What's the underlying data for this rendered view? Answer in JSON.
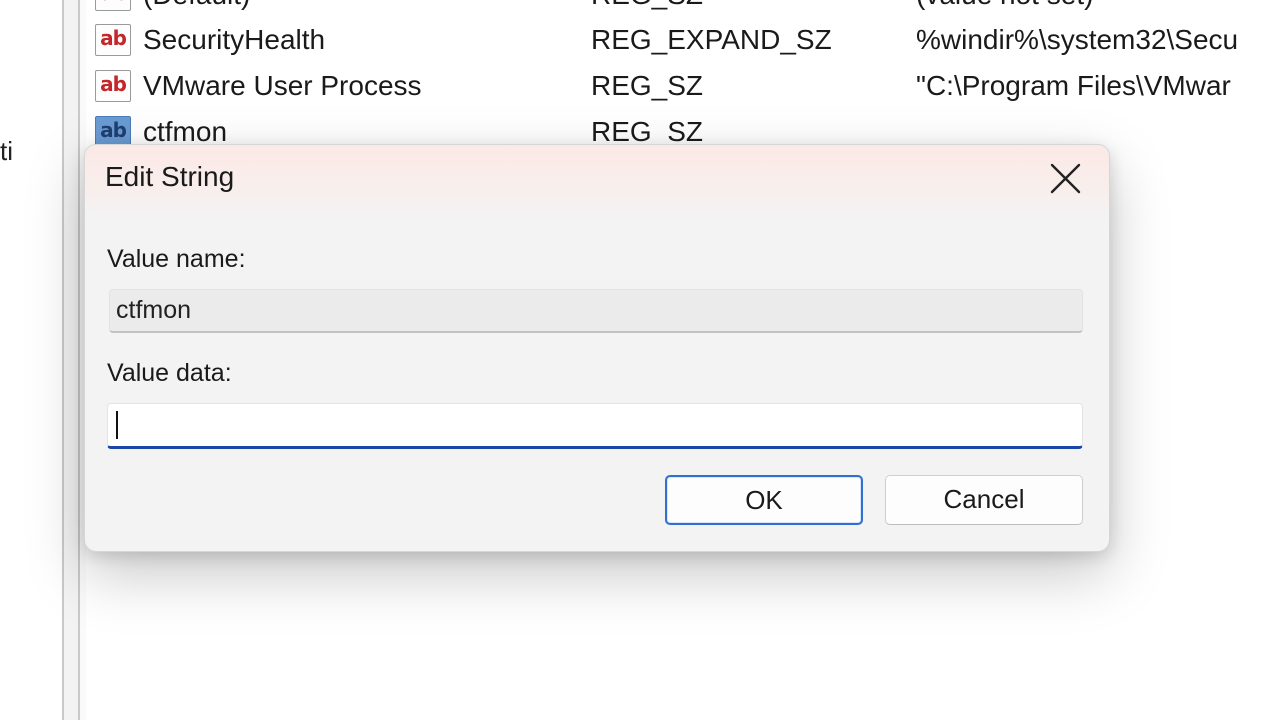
{
  "left_pane": {
    "partial_text": "ti"
  },
  "values": [
    {
      "icon": "ab",
      "name": "(Default)",
      "type": "REG_SZ",
      "data": "(value not set)"
    },
    {
      "icon": "ab",
      "name": "SecurityHealth",
      "type": "REG_EXPAND_SZ",
      "data": "%windir%\\system32\\Secu"
    },
    {
      "icon": "ab",
      "name": "VMware User Process",
      "type": "REG_SZ",
      "data": "\"C:\\Program Files\\VMwar"
    },
    {
      "icon": "ab",
      "name": "ctfmon",
      "type": "REG_SZ",
      "data": ""
    }
  ],
  "dialog": {
    "title": "Edit String",
    "value_name_label": "Value name:",
    "value_name": "ctfmon",
    "value_data_label": "Value data:",
    "value_data": "",
    "ok_label": "OK",
    "cancel_label": "Cancel"
  },
  "colors": {
    "icon_text": "#c3262b",
    "focus_underline": "#1a46a8",
    "ok_border": "#2f6fd0"
  }
}
